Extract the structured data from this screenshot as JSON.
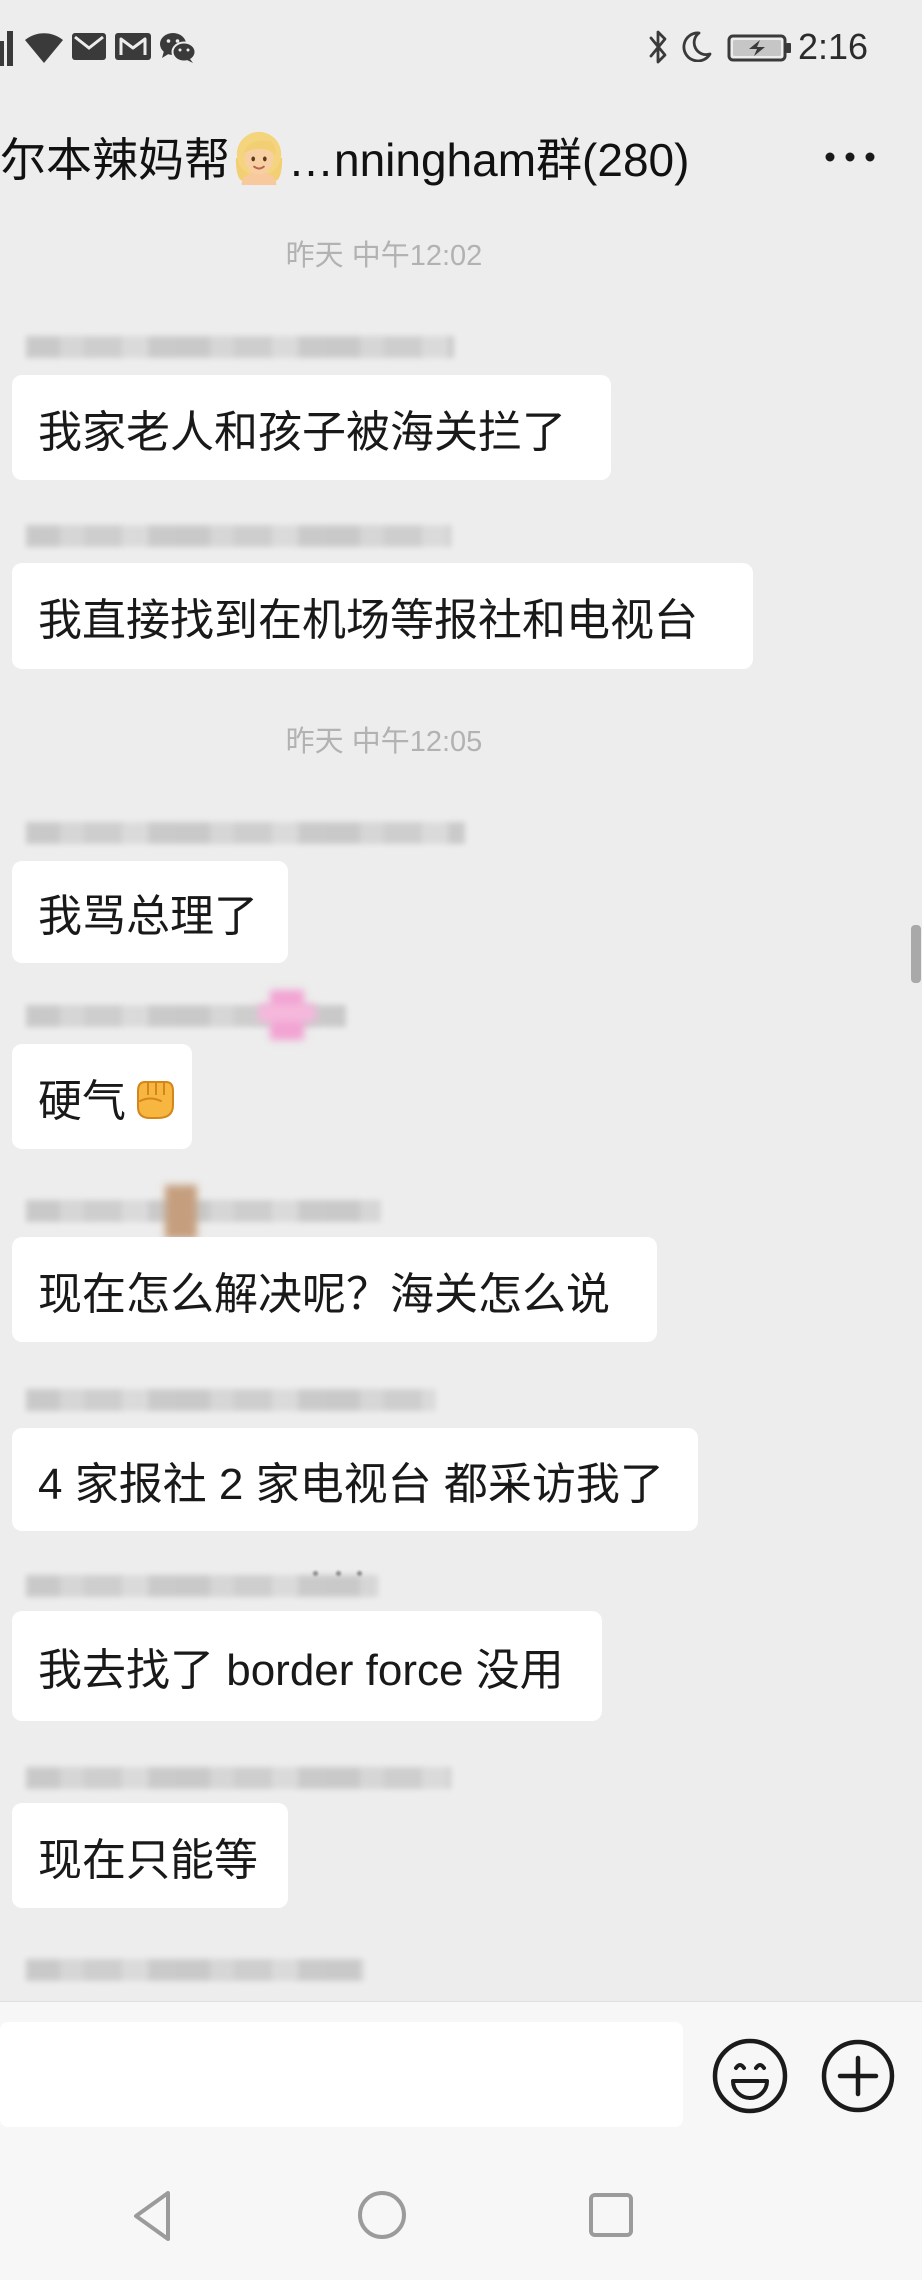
{
  "status_bar": {
    "time": "2:16",
    "left_icons": [
      "signal-icon",
      "wifi-icon",
      "mail-icon",
      "gmail-icon",
      "wechat-icon"
    ],
    "right_icons": [
      "bluetooth-icon",
      "do-not-disturb-moon-icon",
      "battery-charging-icon"
    ]
  },
  "header": {
    "title_prefix": "尔本辣妈帮",
    "title_emoji": "woman-blond-hair-emoji-icon",
    "title_suffix": "…nningham群(280)",
    "more_icon": "more-dots-icon"
  },
  "chat": {
    "timestamps": [
      "昨天 中午12:02",
      "昨天 中午12:05"
    ],
    "messages": [
      {
        "text": "我家老人和孩子被海关拦了"
      },
      {
        "text": "我直接找到在机场等报社和电视台"
      },
      {
        "text": "我骂总理了"
      },
      {
        "text": "硬气",
        "emoji": "raised-fist-emoji-icon"
      },
      {
        "text": "现在怎么解决呢？海关怎么说"
      },
      {
        "text": "4 家报社 2 家电视台 都采访我了"
      },
      {
        "text": "我去找了 border force 没用"
      },
      {
        "text": "现在只能等"
      }
    ]
  },
  "input_bar": {
    "value": "",
    "emoji_icon": "emoji-face-icon",
    "plus_icon": "plus-circle-icon"
  },
  "nav_bar": {
    "icons": [
      "back-triangle-icon",
      "home-circle-icon",
      "recent-apps-square-icon"
    ]
  },
  "colors": {
    "chat_background": "#ededed",
    "bubble_background": "#ffffff",
    "message_text": "#191919",
    "timestamp_text": "#b2b2b2",
    "bottom_bar_background": "#f7f7f7"
  }
}
